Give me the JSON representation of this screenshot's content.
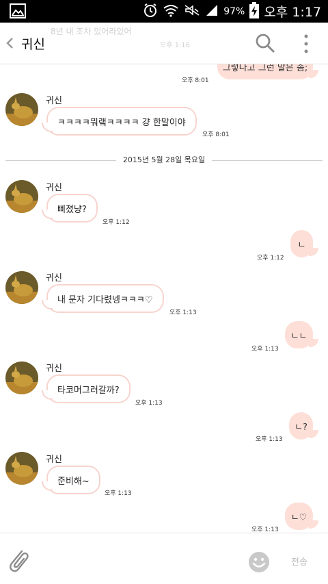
{
  "status_bar": {
    "battery_percent": "97%",
    "clock": "오후 1:17"
  },
  "header": {
    "title": "귀신",
    "ghost_preview": "8년 내 조차 있어라있어",
    "ghost_time": "오후 1:16"
  },
  "messages": [
    {
      "dir": "out",
      "text": "그렇다고 그런 말은 좀;",
      "time": "오후 8:01"
    },
    {
      "dir": "in",
      "sender": "귀신",
      "text": "ㅋㅋㅋㅋ뭐랰ㅋㅋㅋㅋ 걍 한말이야",
      "time": "오후 8:01"
    },
    {
      "dir": "in",
      "sender": "귀신",
      "text": "삐졌냥?",
      "time": "오후 1:12"
    },
    {
      "dir": "out",
      "text": "ㄴ",
      "time": "오후 1:12"
    },
    {
      "dir": "in",
      "sender": "귀신",
      "text": "내 문자 기다렸넹ㅋㅋㅋ♡",
      "time": "오후 1:13"
    },
    {
      "dir": "out",
      "text": "ㄴㄴ",
      "time": "오후 1:13"
    },
    {
      "dir": "in",
      "sender": "귀신",
      "text": "타코머그러갈까?",
      "time": "오후 1:13"
    },
    {
      "dir": "out",
      "text": "ㄴ?",
      "time": "오후 1:13"
    },
    {
      "dir": "in",
      "sender": "귀신",
      "text": "준비해~",
      "time": "오후 1:13"
    },
    {
      "dir": "out",
      "text": "ㄴ♡",
      "time": "오후 1:13"
    }
  ],
  "date_divider": "2015년 5월 28일 목요일",
  "input_bar": {
    "send_label": "전송"
  },
  "colors": {
    "outgoing_bubble": "#fddfd8",
    "incoming_border": "#f7d4ce"
  }
}
